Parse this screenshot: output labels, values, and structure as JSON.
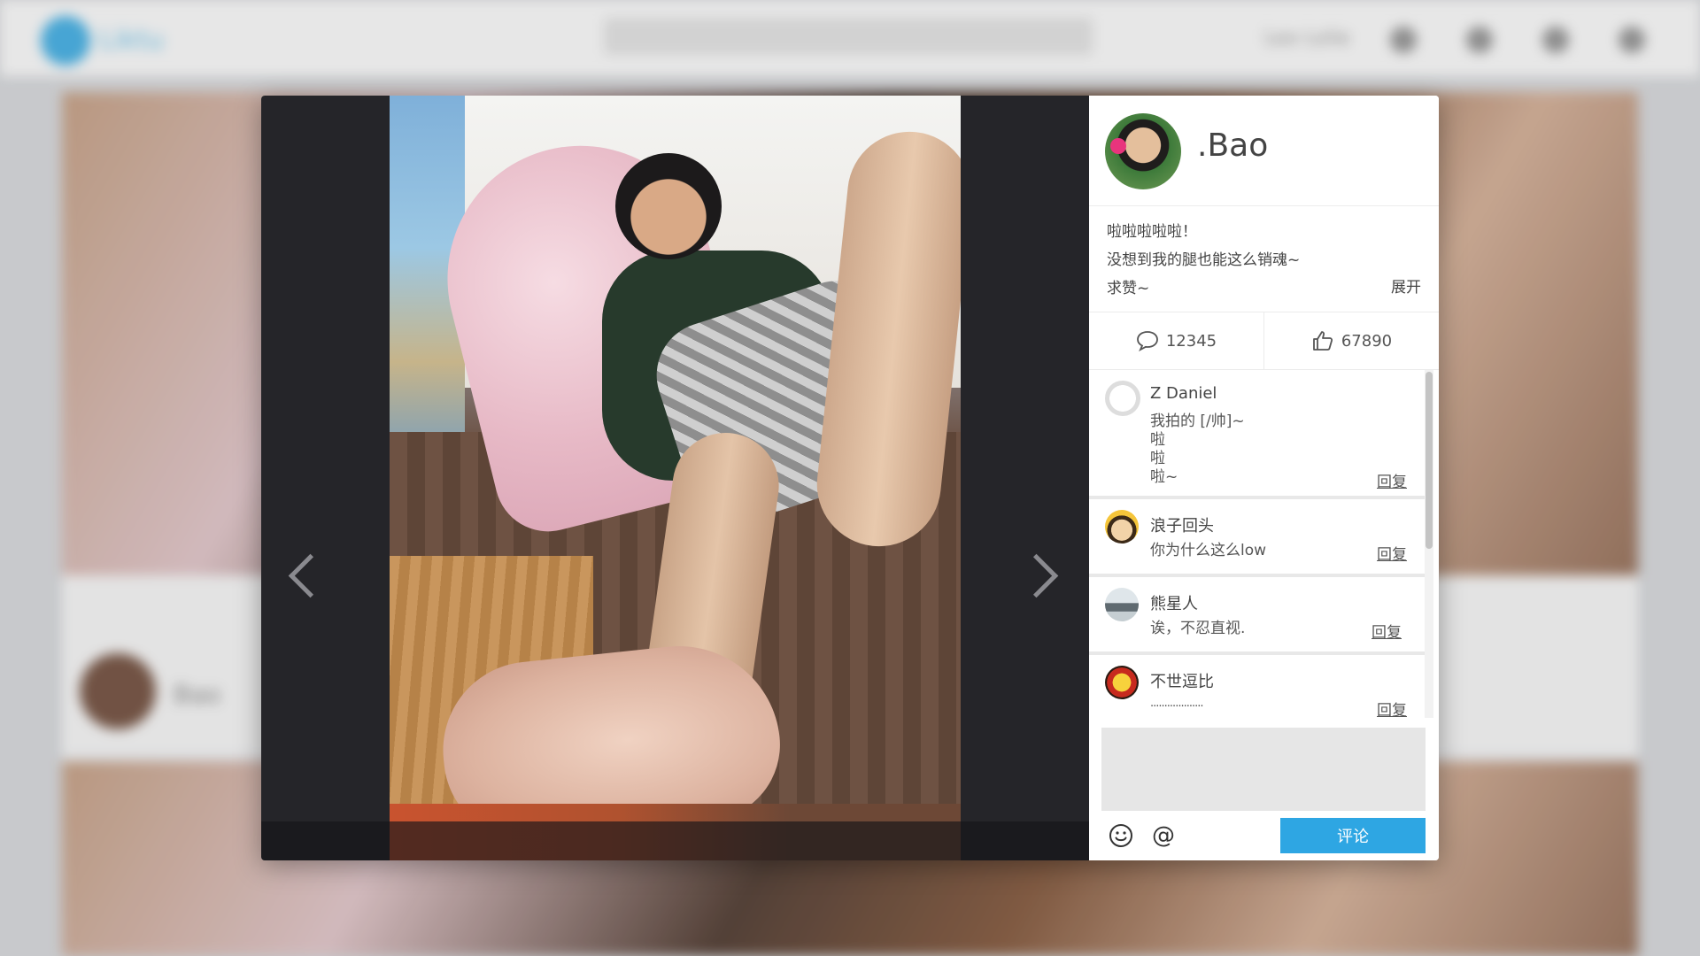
{
  "background": {
    "logo_text": "Liktu",
    "user_name": "Leo Lolie",
    "author_name": "Bao"
  },
  "modal": {
    "author": {
      "name": ".Bao"
    },
    "caption": {
      "lines": [
        "啦啦啦啦啦！",
        "没想到我的腿也能这么销魂~",
        "求赞~"
      ],
      "expand_label": "展开"
    },
    "stats": {
      "comments": "12345",
      "likes": "67890"
    },
    "comments": [
      {
        "name": "Z Daniel",
        "lines": [
          "我拍的 [/帅]~",
          "啦",
          "啦",
          "啦~"
        ],
        "reply": "回复"
      },
      {
        "name": "浪子回头",
        "lines": [
          "你为什么这么low"
        ],
        "reply": "回复"
      },
      {
        "name": "熊星人",
        "lines": [
          "诶，不忍直视."
        ],
        "reply": "回复"
      },
      {
        "name": "不世逗比",
        "lines": [
          "..................."
        ],
        "reply": "回复"
      }
    ],
    "composer": {
      "placeholder": "",
      "submit_label": "评论",
      "at_label": "@"
    }
  },
  "colors": {
    "accent": "#2ea6e3",
    "overlay_dark": "#252529"
  },
  "icons": [
    "chevron-left-icon",
    "chevron-right-icon",
    "comment-icon",
    "thumbs-up-icon",
    "emoji-icon",
    "at-icon",
    "search-icon"
  ]
}
